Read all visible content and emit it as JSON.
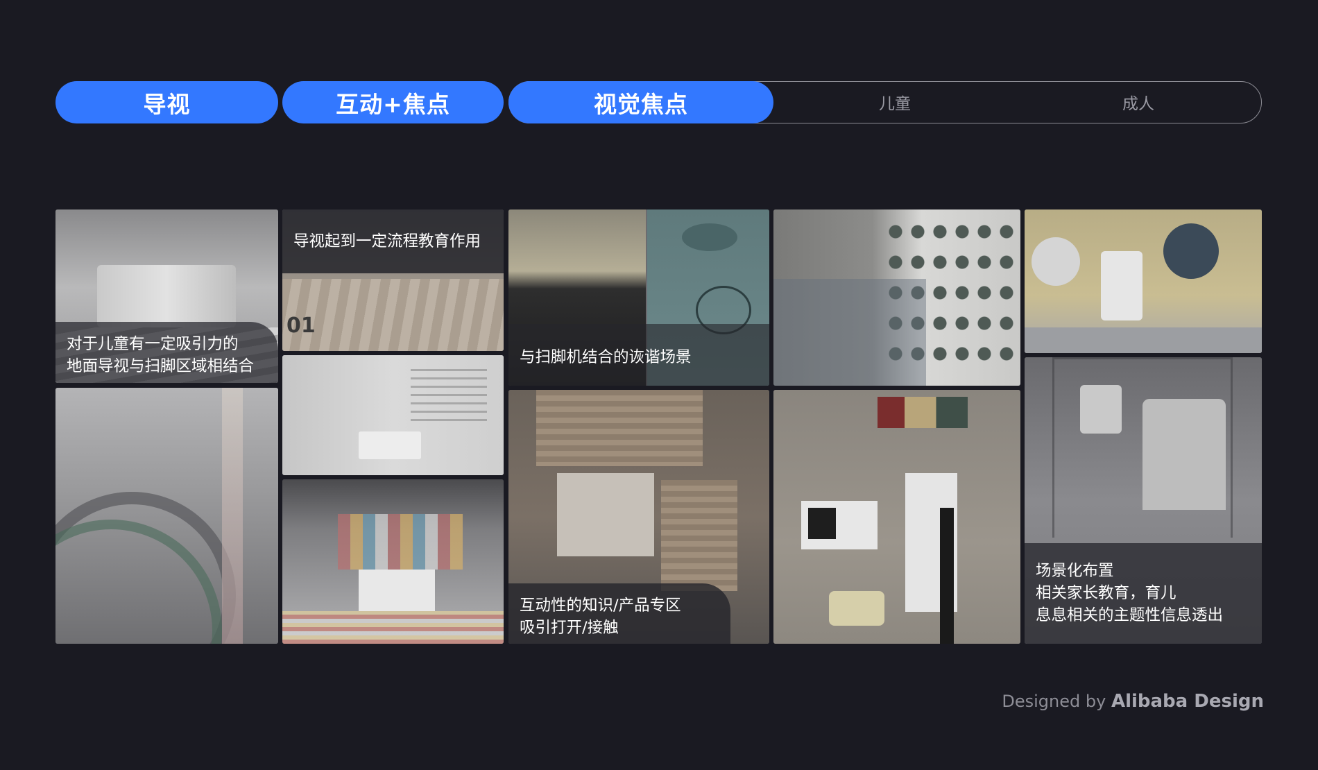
{
  "tabs": {
    "guide": "导视",
    "interactive": "互动+焦点",
    "visual": "视觉焦点",
    "children": "儿童",
    "adults": "成人"
  },
  "captions": {
    "c1_line1": "对于儿童有一定吸引力的",
    "c1_line2": "地面导视与扫脚区域相结合",
    "c2": "导视起到一定流程教育作用",
    "c3": "与扫脚机结合的诙谐场景",
    "c4_line1": "互动性的知识/产品专区",
    "c4_line2": "吸引打开/接触",
    "c5_line1": "场景化布置",
    "c5_line2": "相关家长教育，育儿",
    "c5_line3": "息息相关的主题性信息透出"
  },
  "footer": {
    "prefix": "Designed by ",
    "brand": "Alibaba Design"
  },
  "colors": {
    "background": "#1a1a22",
    "accent": "#3378ff",
    "outline": "#8e8e96"
  }
}
